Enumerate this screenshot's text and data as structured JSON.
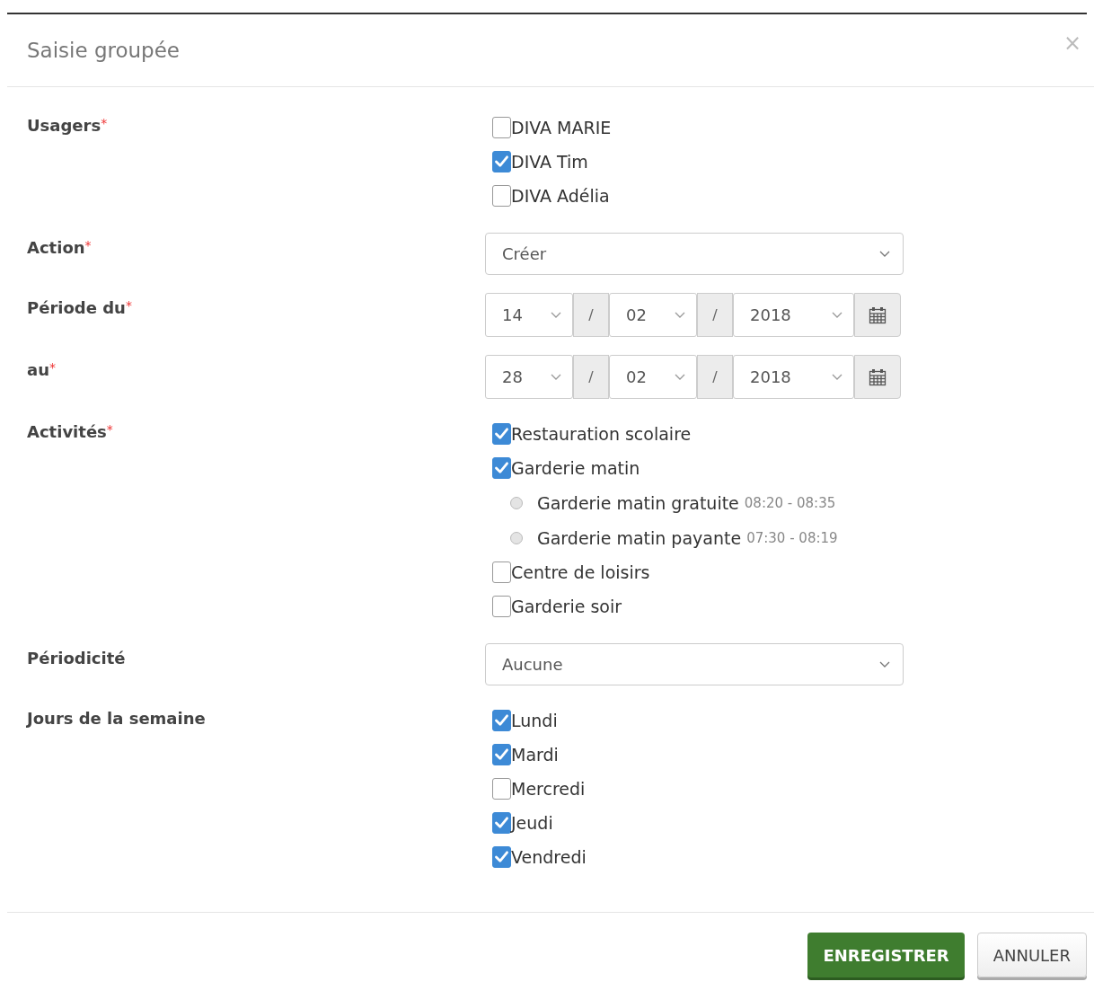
{
  "dialog": {
    "title": "Saisie groupée",
    "close": "×"
  },
  "fields": [
    {
      "kind": "checks",
      "label": "Usagers",
      "required_mark": "*",
      "options": [
        {
          "label": "DIVA MARIE",
          "checked": false
        },
        {
          "label": "DIVA Tim",
          "checked": true
        },
        {
          "label": "DIVA Adélia",
          "checked": false
        }
      ]
    },
    {
      "kind": "select",
      "label": "Action",
      "required_mark": "*",
      "value": "Créer"
    },
    {
      "kind": "date",
      "label": "Période du",
      "required_mark": "*",
      "day": "14",
      "month": "02",
      "year": "2018",
      "separators": [
        "/",
        "/"
      ]
    },
    {
      "kind": "date",
      "label": "au",
      "required_mark": "*",
      "day": "28",
      "month": "02",
      "year": "2018",
      "separators": [
        "/",
        "/"
      ]
    },
    {
      "kind": "checks",
      "label": "Activités",
      "required_mark": "*",
      "options": [
        {
          "label": "Restauration scolaire",
          "checked": true
        },
        {
          "label": "Garderie matin",
          "checked": true,
          "children": [
            {
              "label": "Garderie matin gratuite",
              "time": "08:20 - 08:35",
              "selected": false
            },
            {
              "label": "Garderie matin payante",
              "time": "07:30 - 08:19",
              "selected": false
            }
          ]
        },
        {
          "label": "Centre de loisirs",
          "checked": false
        },
        {
          "label": "Garderie soir",
          "checked": false
        }
      ]
    },
    {
      "kind": "select",
      "label": "Périodicité",
      "value": "Aucune"
    },
    {
      "kind": "checks",
      "label": "Jours de la semaine",
      "options": [
        {
          "label": "Lundi",
          "checked": true
        },
        {
          "label": "Mardi",
          "checked": true
        },
        {
          "label": "Mercredi",
          "checked": false
        },
        {
          "label": "Jeudi",
          "checked": true
        },
        {
          "label": "Vendredi",
          "checked": true
        }
      ]
    }
  ],
  "buttons": [
    {
      "label": "ENREGISTRER",
      "kind": "primary"
    },
    {
      "label": "ANNULER",
      "kind": "default"
    }
  ]
}
